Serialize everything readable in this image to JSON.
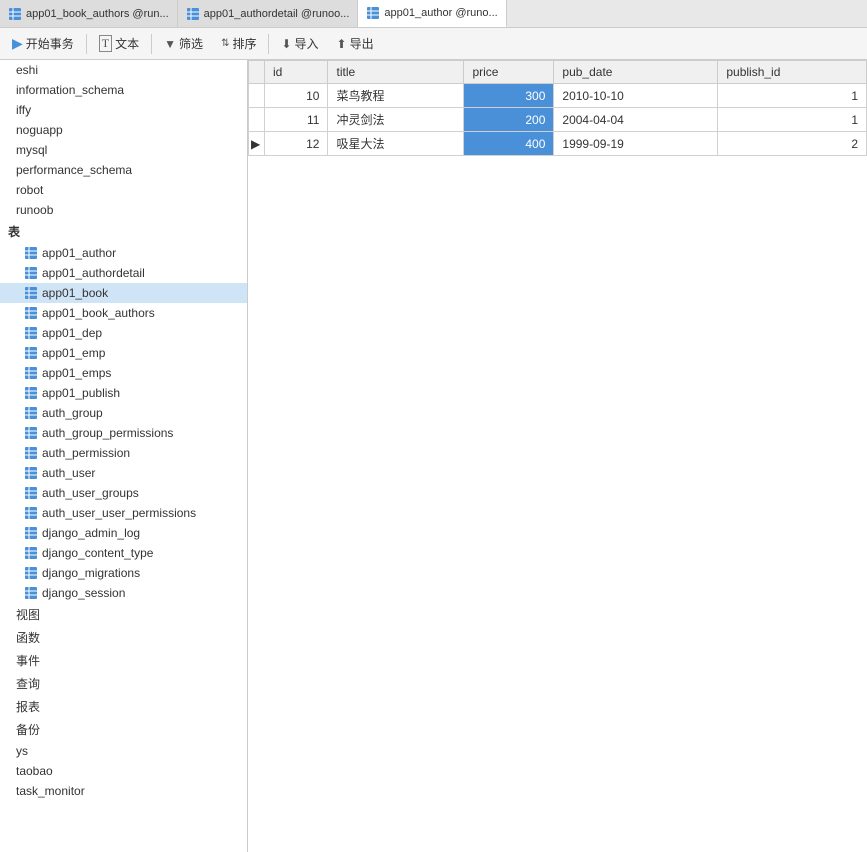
{
  "tabs": [
    {
      "label": "app01_book_authors @run...",
      "active": false
    },
    {
      "label": "app01_authordetail @runoo...",
      "active": false
    },
    {
      "label": "app01_author @runo...",
      "active": true
    }
  ],
  "toolbar": {
    "buttons": [
      {
        "icon": "play-icon",
        "label": "开始事务"
      },
      {
        "icon": "text-icon",
        "label": "文本"
      },
      {
        "icon": "filter-icon",
        "label": "筛选"
      },
      {
        "icon": "sort-icon",
        "label": "排序"
      },
      {
        "icon": "import-icon",
        "label": "导入"
      },
      {
        "icon": "export-icon",
        "label": "导出"
      }
    ]
  },
  "sidebar": {
    "sections": [
      {
        "items": [
          {
            "label": "eshi",
            "type": "db",
            "indent": true
          },
          {
            "label": "information_schema",
            "type": "db",
            "indent": false
          },
          {
            "label": "iffy",
            "type": "db",
            "indent": false
          },
          {
            "label": "noguapp",
            "type": "db",
            "indent": false
          },
          {
            "label": "mysql",
            "type": "db",
            "indent": false
          },
          {
            "label": "performance_schema",
            "type": "db",
            "indent": false
          },
          {
            "label": "robot",
            "type": "db",
            "indent": false
          },
          {
            "label": "runoob",
            "type": "db",
            "indent": false
          }
        ]
      },
      {
        "header": "表",
        "items": [
          {
            "label": "app01_author",
            "type": "table"
          },
          {
            "label": "app01_authordetail",
            "type": "table"
          },
          {
            "label": "app01_book",
            "type": "table",
            "selected": true
          },
          {
            "label": "app01_book_authors",
            "type": "table"
          },
          {
            "label": "app01_dep",
            "type": "table"
          },
          {
            "label": "app01_emp",
            "type": "table"
          },
          {
            "label": "app01_emps",
            "type": "table"
          },
          {
            "label": "app01_publish",
            "type": "table"
          },
          {
            "label": "auth_group",
            "type": "table"
          },
          {
            "label": "auth_group_permissions",
            "type": "table"
          },
          {
            "label": "auth_permission",
            "type": "table"
          },
          {
            "label": "auth_user",
            "type": "table"
          },
          {
            "label": "auth_user_groups",
            "type": "table"
          },
          {
            "label": "auth_user_user_permissions",
            "type": "table"
          },
          {
            "label": "django_admin_log",
            "type": "table"
          },
          {
            "label": "django_content_type",
            "type": "table"
          },
          {
            "label": "django_migrations",
            "type": "table"
          },
          {
            "label": "django_session",
            "type": "table"
          }
        ]
      },
      {
        "items": [
          {
            "label": "视图",
            "type": "section"
          },
          {
            "label": "函数",
            "type": "section"
          },
          {
            "label": "事件",
            "type": "section"
          },
          {
            "label": "查询",
            "type": "section"
          },
          {
            "label": "报表",
            "type": "section"
          },
          {
            "label": "备份",
            "type": "section"
          }
        ]
      },
      {
        "items": [
          {
            "label": "ys",
            "type": "db"
          },
          {
            "label": "taobao",
            "type": "db"
          },
          {
            "label": "task_monitor",
            "type": "db"
          }
        ]
      }
    ]
  },
  "table": {
    "columns": [
      "",
      "id",
      "title",
      "price",
      "pub_date",
      "publish_id"
    ],
    "rows": [
      {
        "indicator": "",
        "id": "10",
        "title": "菜鸟教程",
        "price": "300",
        "pub_date": "2010-10-10",
        "publish_id": "1",
        "selected": false
      },
      {
        "indicator": "",
        "id": "11",
        "title": "冲灵剑法",
        "price": "200",
        "pub_date": "2004-04-04",
        "publish_id": "1",
        "selected": false
      },
      {
        "indicator": "▶",
        "id": "12",
        "title": "吸星大法",
        "price": "400",
        "pub_date": "1999-09-19",
        "publish_id": "2",
        "selected": false
      }
    ]
  }
}
